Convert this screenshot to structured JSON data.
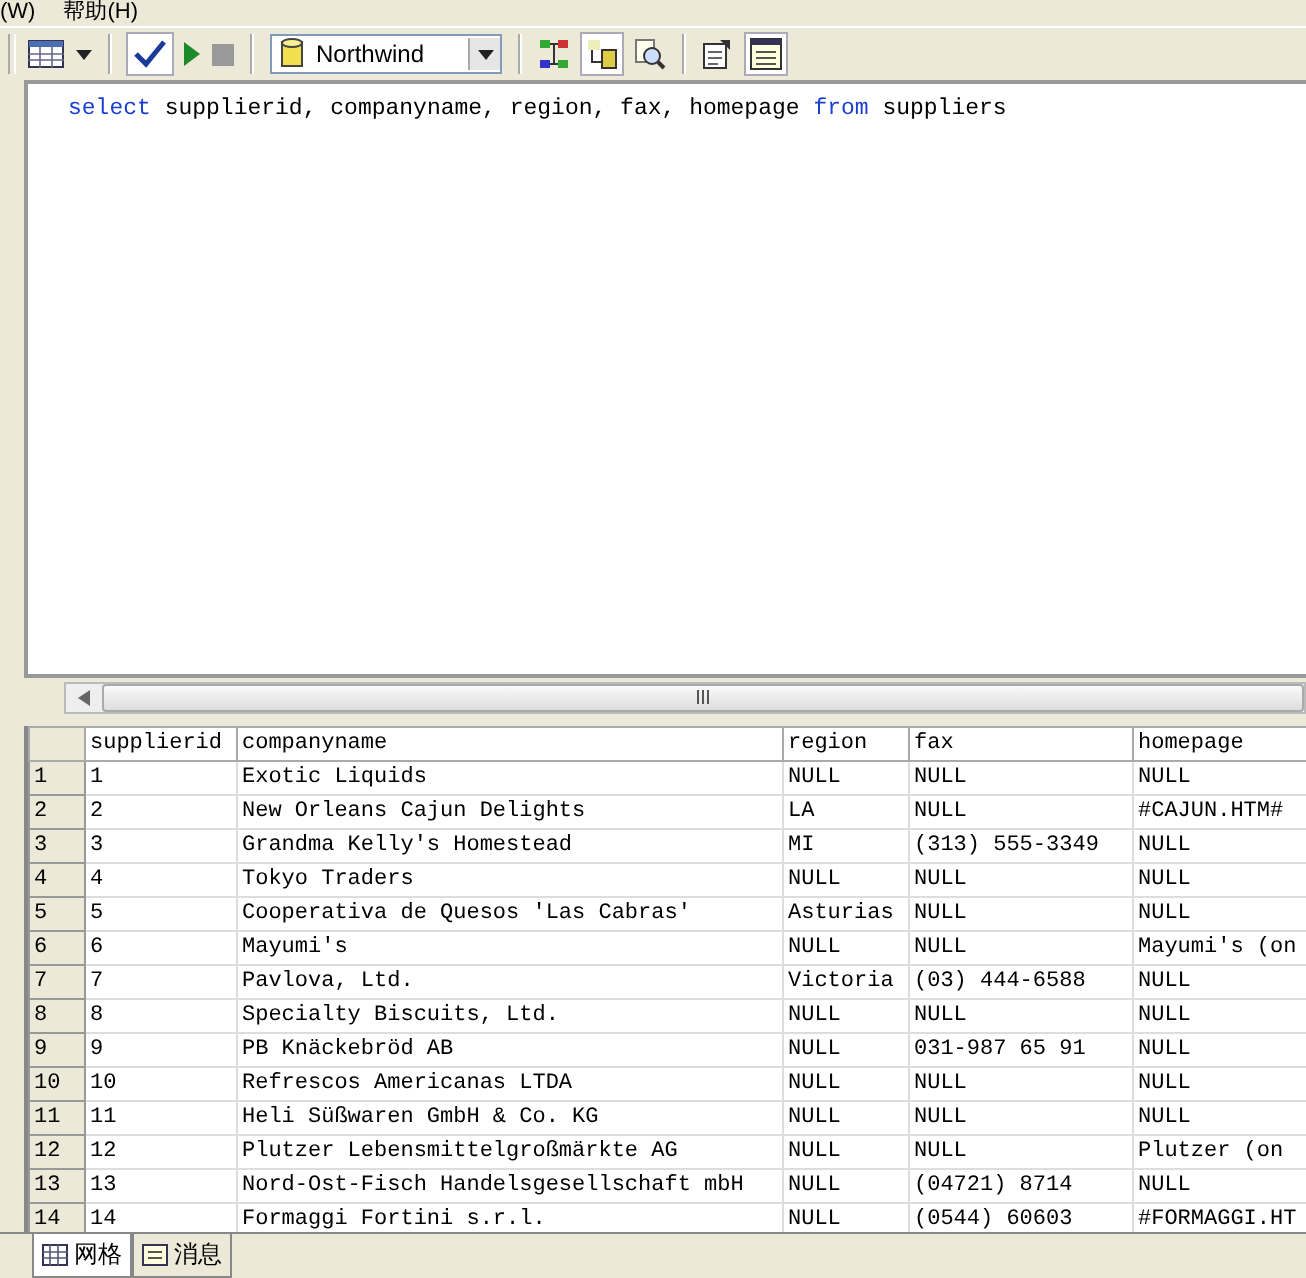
{
  "menu": [
    "(W)",
    "帮助(H)"
  ],
  "toolbar": {
    "database": "Northwind"
  },
  "query": [
    {
      "text": "select",
      "kind": "keyword"
    },
    {
      "text": " supplierid, companyname, region, fax, homepage ",
      "kind": "plain"
    },
    {
      "text": "from",
      "kind": "keyword"
    },
    {
      "text": " suppliers",
      "kind": "plain"
    }
  ],
  "grid": {
    "columns": [
      "supplierid",
      "companyname",
      "region",
      "fax",
      "homepage"
    ],
    "rows": [
      {
        "number": "1",
        "cells": [
          "1",
          "Exotic Liquids",
          "NULL",
          "NULL",
          "NULL"
        ]
      },
      {
        "number": "2",
        "cells": [
          "2",
          "New Orleans Cajun Delights",
          "LA",
          "NULL",
          "#CAJUN.HTM#"
        ]
      },
      {
        "number": "3",
        "cells": [
          "3",
          "Grandma Kelly's Homestead",
          "MI",
          "(313) 555-3349",
          "NULL"
        ]
      },
      {
        "number": "4",
        "cells": [
          "4",
          "Tokyo Traders",
          "NULL",
          "NULL",
          "NULL"
        ]
      },
      {
        "number": "5",
        "cells": [
          "5",
          "Cooperativa de Quesos 'Las Cabras'",
          "Asturias",
          "NULL",
          "NULL"
        ]
      },
      {
        "number": "6",
        "cells": [
          "6",
          "Mayumi's",
          "NULL",
          "NULL",
          "Mayumi's (on"
        ]
      },
      {
        "number": "7",
        "cells": [
          "7",
          "Pavlova, Ltd.",
          "Victoria",
          "(03) 444-6588",
          "NULL"
        ]
      },
      {
        "number": "8",
        "cells": [
          "8",
          "Specialty Biscuits, Ltd.",
          "NULL",
          "NULL",
          "NULL"
        ]
      },
      {
        "number": "9",
        "cells": [
          "9",
          "PB Knäckebröd AB",
          "NULL",
          "031-987 65 91",
          "NULL"
        ]
      },
      {
        "number": "10",
        "cells": [
          "10",
          "Refrescos Americanas LTDA",
          "NULL",
          "NULL",
          "NULL"
        ]
      },
      {
        "number": "11",
        "cells": [
          "11",
          "Heli Süßwaren GmbH & Co. KG",
          "NULL",
          "NULL",
          "NULL"
        ]
      },
      {
        "number": "12",
        "cells": [
          "12",
          "Plutzer Lebensmittelgroßmärkte AG",
          "NULL",
          "NULL",
          "Plutzer (on"
        ]
      },
      {
        "number": "13",
        "cells": [
          "13",
          "Nord-Ost-Fisch Handelsgesellschaft mbH",
          "NULL",
          "(04721) 8714",
          "NULL"
        ]
      },
      {
        "number": "14",
        "cells": [
          "14",
          "Formaggi Fortini s.r.l.",
          "NULL",
          "(0544) 60603",
          "#FORMAGGI.HT"
        ]
      }
    ]
  },
  "tabs": [
    {
      "label": "网格",
      "selected": true
    },
    {
      "label": "消息",
      "selected": false
    }
  ]
}
